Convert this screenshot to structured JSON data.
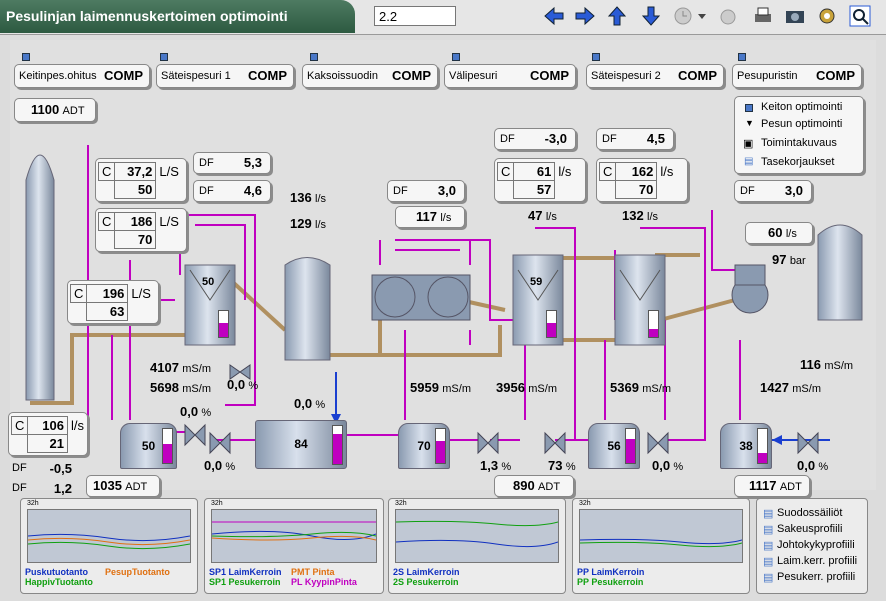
{
  "title": "Pesulinjan laimennuskertoimen optimointi",
  "code_field": "2.2",
  "tabs": [
    {
      "label": "Keitinpes.ohitus",
      "comp": "COMP"
    },
    {
      "label": "Säteispesuri 1",
      "comp": "COMP"
    },
    {
      "label": "Kaksoissuodin",
      "comp": "COMP"
    },
    {
      "label": "Välipesuri",
      "comp": "COMP"
    },
    {
      "label": "Säteispesuri 2",
      "comp": "COMP"
    },
    {
      "label": "Pesupuristin",
      "comp": "COMP"
    }
  ],
  "menu": [
    "Keiton optimointi",
    "Pesun optimointi",
    "Toimintakuvaus",
    "Tasekorjaukset"
  ],
  "adt_top": {
    "value": "1100",
    "unit": "ADT"
  },
  "adt_bottom": [
    {
      "value": "1035",
      "unit": "ADT"
    },
    {
      "value": "890",
      "unit": "ADT"
    },
    {
      "value": "1117",
      "unit": "ADT"
    }
  ],
  "ctrl": {
    "c1": {
      "l": "C",
      "v1": "37,2",
      "v2": "50",
      "unit": "L/S"
    },
    "c2": {
      "l": "C",
      "v1": "186",
      "v2": "70",
      "unit": "L/S"
    },
    "c3": {
      "l": "C",
      "v1": "196",
      "v2": "63",
      "unit": "L/S"
    },
    "c4": {
      "l": "C",
      "v1": "106",
      "v2": "21",
      "unit": "l/s"
    },
    "c5": {
      "l": "C",
      "v1": "61",
      "v2": "57",
      "unit": "l/s"
    },
    "c6": {
      "l": "C",
      "v1": "162",
      "v2": "70",
      "unit": "l/s"
    }
  },
  "df": {
    "a": {
      "l": "DF",
      "v": "5,3"
    },
    "b": {
      "l": "DF",
      "v": "4,6"
    },
    "c": {
      "l": "DF",
      "v": "3,0"
    },
    "d": {
      "l": "DF",
      "v": "-3,0"
    },
    "e": {
      "l": "DF",
      "v": "4,5"
    },
    "f": {
      "l": "DF",
      "v": "3,0"
    },
    "g": {
      "l": "DF",
      "v": "-0,5"
    },
    "h": {
      "l": "DF",
      "v": "1,2"
    }
  },
  "flows": {
    "f136": {
      "v": "136",
      "u": "l/s"
    },
    "f129": {
      "v": "129",
      "u": "l/s"
    },
    "f117": {
      "v": "117",
      "u": "l/s"
    },
    "f47": {
      "v": "47",
      "u": "l/s"
    },
    "f132": {
      "v": "132",
      "u": "l/s"
    },
    "f60": {
      "v": "60",
      "u": "l/s"
    },
    "p97": {
      "v": "97",
      "u": "bar"
    }
  },
  "conduct": {
    "m4107": {
      "v": "4107",
      "u": "mS/m"
    },
    "m5698": {
      "v": "5698",
      "u": "mS/m"
    },
    "m5959": {
      "v": "5959",
      "u": "mS/m"
    },
    "m3956": {
      "v": "3956",
      "u": "mS/m"
    },
    "m5369": {
      "v": "5369",
      "u": "mS/m"
    },
    "m116": {
      "v": "116",
      "u": "mS/m"
    },
    "m1427": {
      "v": "1427",
      "u": "mS/m"
    }
  },
  "valves": {
    "v1": {
      "v": "0,0",
      "u": "%"
    },
    "v2": {
      "v": "0,0",
      "u": "%"
    },
    "v3": {
      "v": "0,0",
      "u": "%"
    },
    "v4": {
      "v": "0,0",
      "u": "%"
    },
    "v5": {
      "v": "1,3",
      "u": "%"
    },
    "v6": {
      "v": "73",
      "u": "%"
    },
    "v7": {
      "v": "0,0",
      "u": "%"
    },
    "v8": {
      "v": "0,0",
      "u": "%"
    }
  },
  "tanks": {
    "t50": "50",
    "t84": "84",
    "t70": "70",
    "t56": "56",
    "t38": "38",
    "w50": "50",
    "w59": "59"
  },
  "levels": {
    "t50": 0.55,
    "t84": 0.8,
    "t70": 0.65,
    "t56": 0.7,
    "t38": 0.3,
    "w1": 0.55,
    "w2": 0.55,
    "w3": 0.3
  },
  "trends": [
    {
      "hdr": "32h",
      "lines": [
        "Puskutuotanto",
        "PesupTuotanto",
        "HappivTuotanto"
      ]
    },
    {
      "hdr": "32h",
      "lines": [
        "SP1 LaimKerroin",
        "PMT Pinta",
        "SP1 Pesukerroin",
        "PL KyypinPinta"
      ]
    },
    {
      "hdr": "32h",
      "lines": [
        "2S LaimKerroin",
        "2S Pesukerroin"
      ]
    },
    {
      "hdr": "32h",
      "lines": [
        "PP LaimKerroin",
        "PP Pesukerroin"
      ]
    }
  ],
  "trend_menu": [
    "Suodossäiliöt",
    "Sakeusprofiili",
    "Johtokykyprofiili",
    "Laim.kerr. profiili",
    "Pesukerr. profiili"
  ],
  "colors": {
    "accent": "#c000c0",
    "pipe": "#b09060",
    "title_bg": "#2d5a41"
  }
}
